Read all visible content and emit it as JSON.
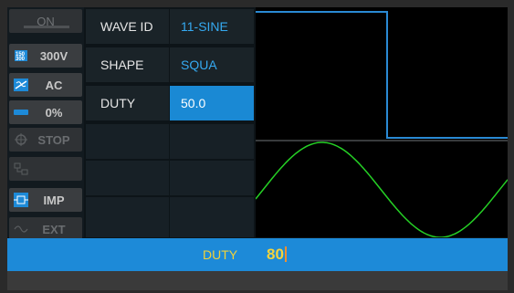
{
  "sidebar": {
    "on_label": "ON",
    "voltage_label": "300V",
    "mode_label": "AC",
    "percent_label": "0%",
    "stop_label": "STOP",
    "imp_label": "IMP",
    "ext_label": "EXT"
  },
  "table": {
    "rows": [
      {
        "label": "WAVE ID",
        "value": "11-SINE"
      },
      {
        "label": "SHAPE",
        "value": "SQUA"
      },
      {
        "label": "DUTY",
        "value": "50.0"
      }
    ]
  },
  "input": {
    "label": "DUTY",
    "value": "80"
  },
  "colors": {
    "accent": "#1d8ad8",
    "square_wave": "#2a8ad4",
    "sine_wave": "#25d025"
  }
}
